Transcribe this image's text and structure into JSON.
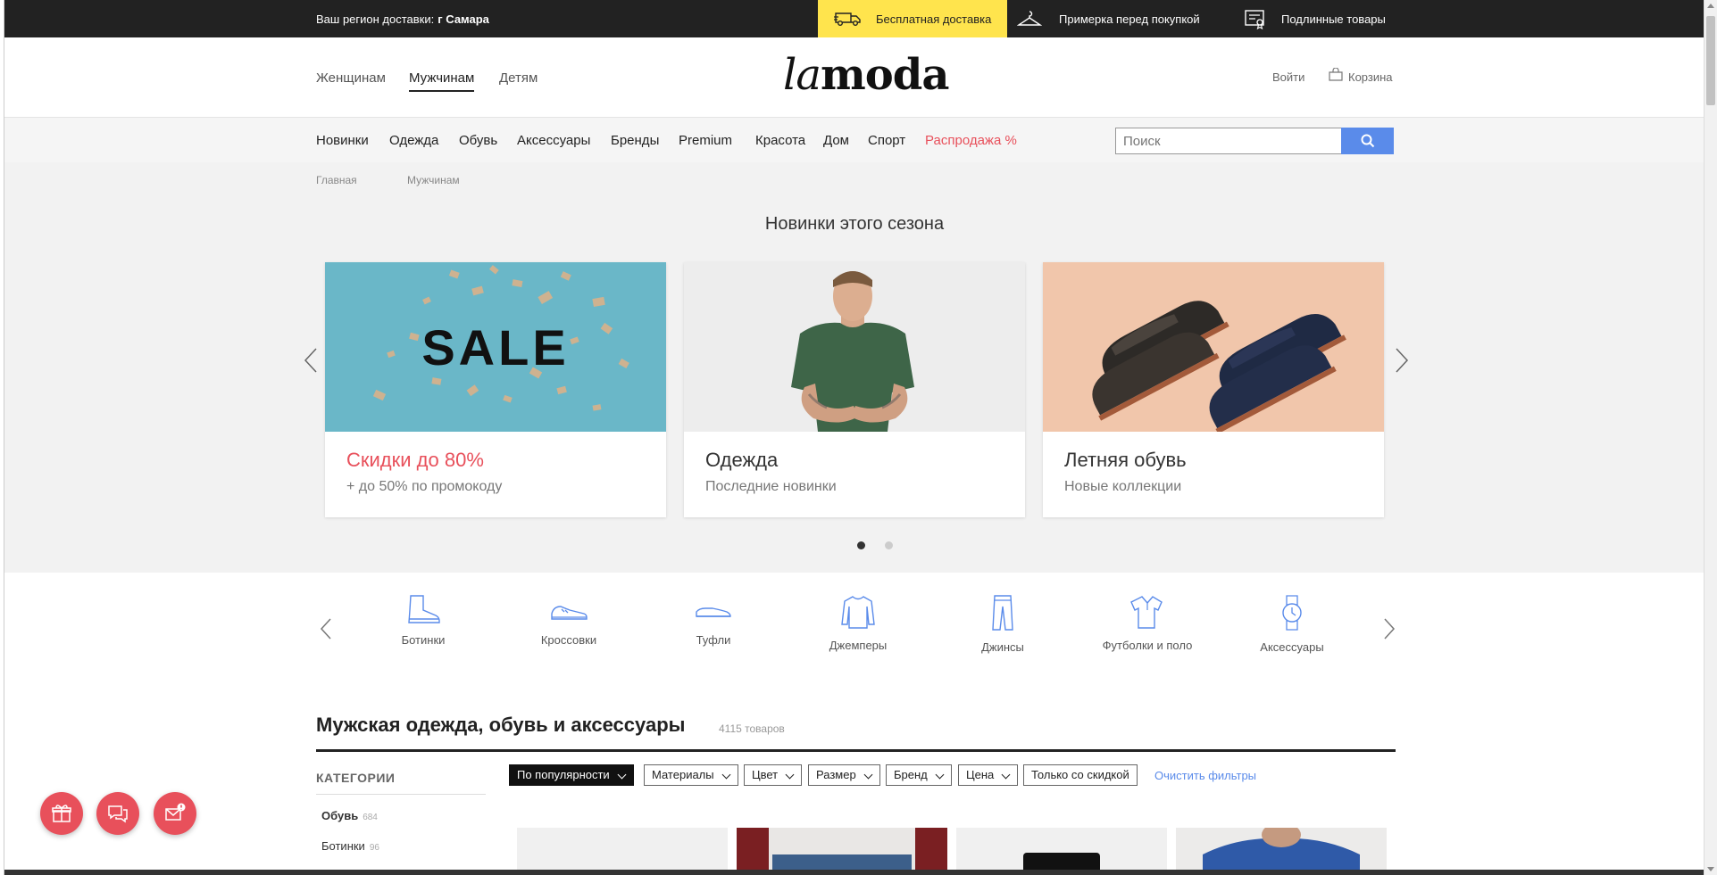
{
  "topbar": {
    "region_label": "Ваш регион доставки:",
    "region_value": "г Самара",
    "free_delivery": "Бесплатная доставка",
    "try_on": "Примерка перед покупкой",
    "original": "Подлинные товары",
    "accent_color": "#ffe44d"
  },
  "header": {
    "genders": [
      "Женщинам",
      "Мужчинам",
      "Детям"
    ],
    "active_gender": "Мужчинам",
    "logo_italic": "la",
    "logo_bold": "moda",
    "login": "Войти",
    "cart": "Корзина"
  },
  "nav": {
    "items": [
      "Новинки",
      "Одежда",
      "Обувь",
      "Аксессуары",
      "Бренды",
      "Premium",
      "Красота",
      "Дом",
      "Спорт"
    ],
    "sale": "Распродажа %",
    "search_placeholder": "Поиск",
    "sale_color": "#e8505b"
  },
  "breadcrumb": [
    "Главная",
    "Мужчинам"
  ],
  "promo": {
    "title": "Новинки этого сезона",
    "cards": [
      {
        "image_text": "SALE",
        "title": "Скидки до 80%",
        "subtitle": "+ до 50% по промокоду"
      },
      {
        "title": "Одежда",
        "subtitle": "Последние новинки"
      },
      {
        "title": "Летняя обувь",
        "subtitle": "Новые коллекции"
      }
    ],
    "active_dot": 0,
    "dot_count": 2
  },
  "categories": [
    {
      "label": "Ботинки",
      "icon": "boot-icon"
    },
    {
      "label": "Кроссовки",
      "icon": "sneaker-icon"
    },
    {
      "label": "Туфли",
      "icon": "shoe-icon"
    },
    {
      "label": "Джемперы",
      "icon": "sweater-icon"
    },
    {
      "label": "Джинсы",
      "icon": "jeans-icon"
    },
    {
      "label": "Футболки и поло",
      "icon": "polo-icon"
    },
    {
      "label": "Аксессуары",
      "icon": "watch-icon"
    }
  ],
  "listing": {
    "title": "Мужская одежда, обувь и аксессуары",
    "count": "4115 товаров",
    "categories_heading": "КАТЕГОРИИ",
    "category_items": [
      {
        "label": "Обувь",
        "count": "684"
      },
      {
        "label": "Ботинки",
        "count": "96"
      }
    ],
    "filters": [
      "По популярности",
      "Материалы",
      "Цвет",
      "Размер",
      "Бренд",
      "Цена",
      "Только со скидкой"
    ],
    "clear_filters": "Очистить фильтры"
  }
}
